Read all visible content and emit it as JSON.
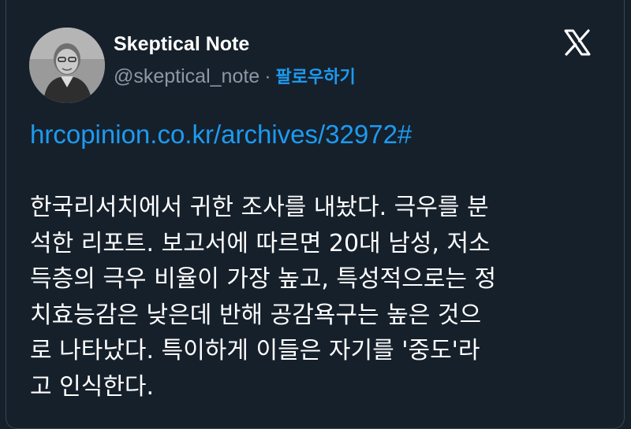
{
  "tweet": {
    "author_name": "Skeptical Note",
    "handle": "@skeptical_note",
    "separator": "·",
    "follow_label": "팔로우하기",
    "platform_icon": "x-logo-icon",
    "link": "hrcopinion.co.kr/archives/32972#",
    "body_lines": [
      "한국리서치에서 귀한 조사를 내놨다. 극우를 분",
      "석한 리포트. 보고서에 따르면 20대 남성, 저소",
      "득층의 극우 비율이 가장 높고, 특성적으로는 정",
      "치효능감은 낮은데 반해 공감욕구는 높은 것으",
      "로 나타났다. 특이하게 이들은 자기를 '중도'라",
      "고 인식한다."
    ]
  },
  "colors": {
    "background": "#15202b",
    "link": "#1d9bf0",
    "secondary_text": "#8b98a5",
    "primary_text": "#ffffff"
  }
}
